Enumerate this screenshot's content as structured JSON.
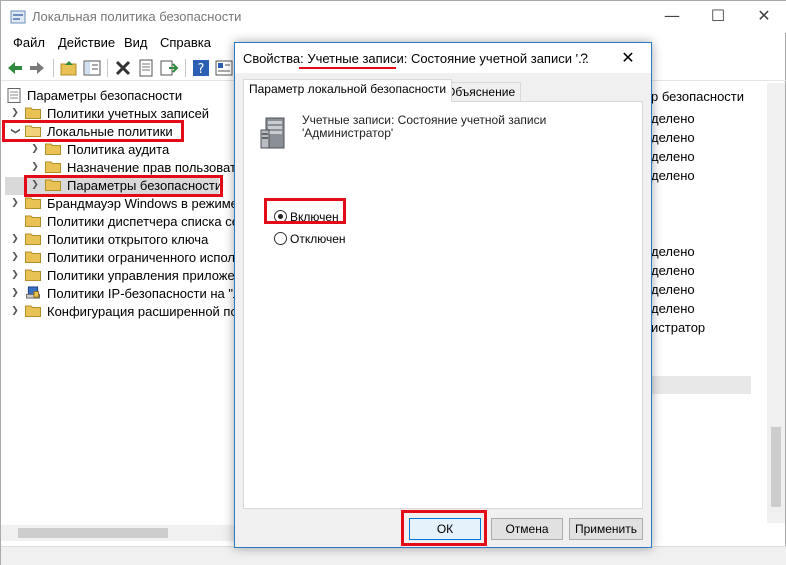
{
  "window": {
    "title": "Локальная политика безопасности",
    "controls": {
      "minimize": "—",
      "maximize": "☐",
      "close": "✕"
    }
  },
  "menu": [
    "Файл",
    "Действие",
    "Вид",
    "Справка"
  ],
  "toolbar": [
    "back",
    "forward",
    "up-folder",
    "show-hide-tree",
    "delete",
    "properties",
    "export",
    "help",
    "filter"
  ],
  "tree": {
    "root": "Параметры безопасности",
    "items": [
      {
        "label": "Политики учетных записей",
        "level": 1,
        "expanded": false
      },
      {
        "label": "Локальные политики",
        "level": 1,
        "expanded": true
      },
      {
        "label": "Политика аудита",
        "level": 2,
        "expanded": false
      },
      {
        "label": "Назначение прав пользовател",
        "level": 2,
        "expanded": false
      },
      {
        "label": "Параметры безопасности",
        "level": 2,
        "expanded": false,
        "selected": true
      },
      {
        "label": "Брандмауэр Windows в режиме пов",
        "level": 1,
        "expanded": false
      },
      {
        "label": "Политики диспетчера списка сете",
        "level": 1,
        "expanded": false
      },
      {
        "label": "Политики открытого ключа",
        "level": 1,
        "expanded": false
      },
      {
        "label": "Политики ограниченного использ",
        "level": 1,
        "expanded": false
      },
      {
        "label": "Политики управления приложени",
        "level": 1,
        "expanded": false
      },
      {
        "label": "Политики IP-безопасности на \"Лок",
        "level": 1,
        "expanded": false
      },
      {
        "label": "Конфигурация расширенной поли",
        "level": 1,
        "expanded": false
      }
    ]
  },
  "right_pane": {
    "header": "р безопасности",
    "values": [
      "делено",
      "делено",
      "делено",
      "делено",
      "",
      "",
      "",
      "делено",
      "делено",
      "делено",
      "делено",
      "истратор",
      "",
      "",
      "",
      "",
      "",
      "",
      ""
    ]
  },
  "dialog": {
    "title_prefix": "Свойства: ",
    "title_highlight": "Учетные записи",
    "title_rest": ": Состояние учетной записи '...",
    "help": "?",
    "close": "✕",
    "tabs": [
      "Параметр локальной безопасности",
      "Объяснение"
    ],
    "policy_text_line1": "Учетные записи: Состояние учетной записи",
    "policy_text_line2": "'Администратор'",
    "options": [
      {
        "label": "Включен",
        "checked": true
      },
      {
        "label": "Отключен",
        "checked": false
      }
    ],
    "buttons": {
      "ok": "ОК",
      "cancel": "Отмена",
      "apply": "Применить"
    }
  },
  "colors": {
    "annotation": "#e30b17",
    "accent": "#0078d7",
    "folder": "#e8c254"
  }
}
